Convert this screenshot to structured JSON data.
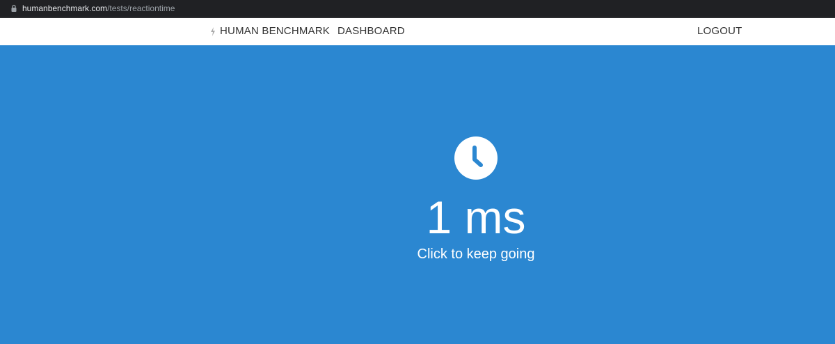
{
  "browser": {
    "url_domain": "humanbenchmark.com",
    "url_path": "/tests/reactiontime"
  },
  "nav": {
    "logo_label": "HUMAN BENCHMARK",
    "dashboard_label": "DASHBOARD",
    "logout_label": "LOGOUT"
  },
  "test": {
    "icon": "clock-icon",
    "result": "1 ms",
    "prompt": "Click to keep going"
  },
  "colors": {
    "background": "#2b87d1",
    "navbar": "#ffffff",
    "browser_bar": "#202124",
    "text_light": "#ffffff"
  }
}
